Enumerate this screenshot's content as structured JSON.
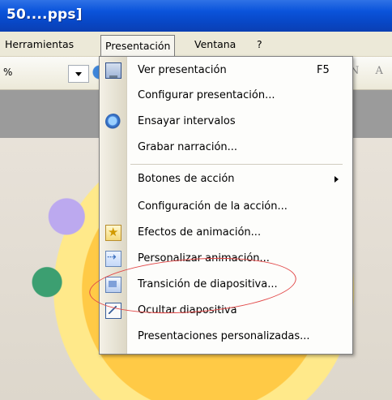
{
  "window": {
    "title": "50....pps]"
  },
  "menubar": {
    "items": [
      {
        "label": "Herramientas"
      },
      {
        "label": "Presentación"
      },
      {
        "label": "Ventana"
      },
      {
        "label": "?"
      }
    ],
    "active_index": 1
  },
  "toolbar": {
    "zoom_label": "%",
    "tail_text": "N A"
  },
  "dropdown": {
    "items": [
      {
        "label": "Ver presentación",
        "shortcut": "F5",
        "icon": "presentation-icon"
      },
      {
        "label": "Configurar presentación...",
        "icon": ""
      },
      {
        "label": "Ensayar intervalos",
        "icon": "stopwatch-icon"
      },
      {
        "label": "Grabar narración...",
        "icon": ""
      },
      {
        "label": "Botones de acción",
        "icon": "",
        "submenu": true
      },
      {
        "label": "Configuración de la acción...",
        "icon": ""
      },
      {
        "label": "Efectos de animación...",
        "icon": "animation-star-icon"
      },
      {
        "label": "Personalizar animación...",
        "icon": "custom-animation-icon"
      },
      {
        "label": "Transición de diapositiva...",
        "icon": "slide-transition-icon"
      },
      {
        "label": "Ocultar diapositiva",
        "icon": "hide-slide-icon"
      },
      {
        "label": "Presentaciones personalizadas...",
        "icon": ""
      }
    ]
  },
  "colors": {
    "titlebar": "#0b54db",
    "menubar": "#ece9d8",
    "annotation": "#e24848"
  }
}
